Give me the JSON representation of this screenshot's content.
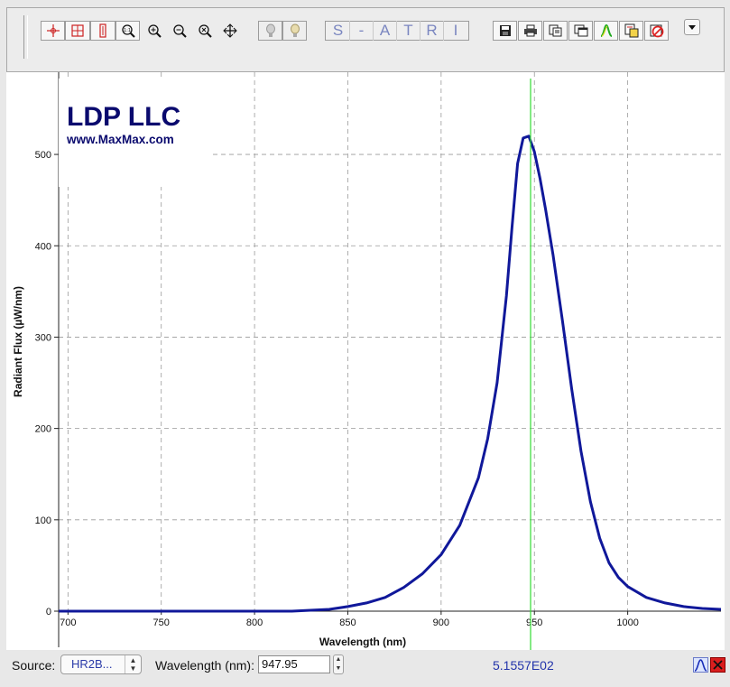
{
  "toolbar": {
    "buttons": [
      {
        "name": "select-cursor-icon"
      },
      {
        "name": "zoom-box-icon"
      },
      {
        "name": "zoom-vertical-icon"
      },
      {
        "name": "zoom-fit-icon"
      },
      {
        "name": "zoom-in-icon"
      },
      {
        "name": "zoom-out-icon"
      },
      {
        "name": "zoom-reset-icon"
      },
      {
        "name": "pan-icon"
      },
      {
        "name": "lamp-off-icon"
      },
      {
        "name": "lamp-on-icon"
      }
    ],
    "letters": [
      "S",
      "-",
      "A",
      "T",
      "R",
      "I"
    ],
    "file_buttons": [
      "save-icon",
      "print-icon",
      "copy-icon",
      "copy-window-icon",
      "spectrum-color-icon",
      "export-icon",
      "delete-icon"
    ]
  },
  "logo": {
    "title": "LDP LLC",
    "url": "www.MaxMax.com"
  },
  "colors": {
    "curve": "#10189a",
    "marker": "#33dd33",
    "logo": "#0a0a6e",
    "value": "#2233aa"
  },
  "chart_data": {
    "type": "line",
    "xlabel": "Wavelength (nm)",
    "ylabel": "Radiant Flux (µW/nm)",
    "xlim": [
      695,
      1050
    ],
    "ylim": [
      0,
      590
    ],
    "xticks": [
      700,
      750,
      800,
      850,
      900,
      950,
      1000
    ],
    "yticks": [
      0,
      100,
      200,
      300,
      400,
      500
    ],
    "grid": true,
    "marker_x": 947.95,
    "series": [
      {
        "x": [
          695,
          750,
          800,
          820,
          830,
          840,
          850,
          860,
          870,
          880,
          890,
          900,
          910,
          920,
          925,
          930,
          935,
          938,
          941,
          944,
          947,
          950,
          953,
          956,
          960,
          965,
          970,
          975,
          980,
          985,
          990,
          995,
          1000,
          1010,
          1020,
          1030,
          1040,
          1050
        ],
        "y": [
          0,
          0,
          0,
          0,
          1,
          2,
          5,
          9,
          15,
          26,
          41,
          62,
          94,
          146,
          189,
          250,
          345,
          420,
          490,
          518,
          520,
          503,
          474,
          440,
          390,
          318,
          243,
          175,
          120,
          80,
          53,
          37,
          27,
          15,
          9,
          5,
          3,
          2
        ]
      }
    ]
  },
  "status": {
    "source_label": "Source:",
    "source_value": "HR2B...",
    "wavelength_label": "Wavelength (nm):",
    "wavelength_value": "947.95",
    "readout": "5.1557E02"
  }
}
